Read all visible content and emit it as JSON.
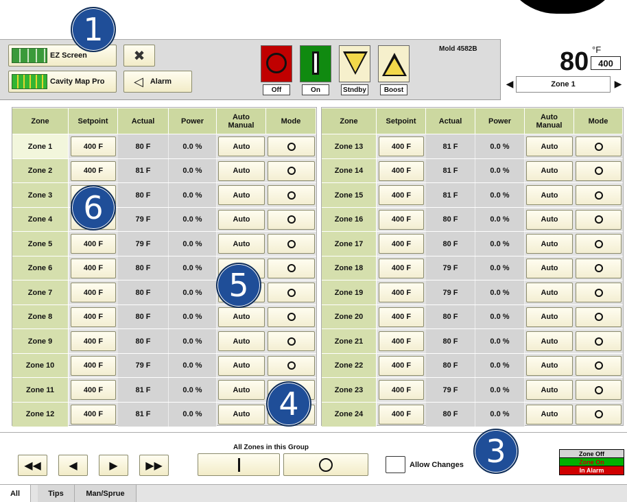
{
  "header": {
    "ez_screen_label": "EZ Screen",
    "cavity_map_label": "Cavity Map Pro",
    "alarm_label": "Alarm",
    "mold_name": "Mold 4582B",
    "states": [
      {
        "label": "Off",
        "color": "#c00000"
      },
      {
        "label": "On",
        "color": "#108a10"
      },
      {
        "label": "Stndby",
        "color": "#f2d84a"
      },
      {
        "label": "Boost",
        "color": "#f2d84a"
      }
    ],
    "current_temp": "80",
    "unit": "°F",
    "setpoint": "400",
    "zone_selector": "Zone 1"
  },
  "table": {
    "columns": [
      "Zone",
      "Setpoint",
      "Actual",
      "Power",
      "Auto\nManual",
      "Mode"
    ],
    "left_rows": [
      {
        "zone": "Zone 1",
        "setpoint": "400 F",
        "actual": "80 F",
        "power": "0.0 %",
        "auto": "Auto"
      },
      {
        "zone": "Zone 2",
        "setpoint": "400 F",
        "actual": "81 F",
        "power": "0.0 %",
        "auto": "Auto"
      },
      {
        "zone": "Zone 3",
        "setpoint": "400 F",
        "actual": "80 F",
        "power": "0.0 %",
        "auto": "Auto"
      },
      {
        "zone": "Zone 4",
        "setpoint": "400 F",
        "actual": "79 F",
        "power": "0.0 %",
        "auto": "Auto"
      },
      {
        "zone": "Zone 5",
        "setpoint": "400 F",
        "actual": "79 F",
        "power": "0.0 %",
        "auto": "Auto"
      },
      {
        "zone": "Zone 6",
        "setpoint": "400 F",
        "actual": "80 F",
        "power": "0.0 %",
        "auto": "Auto"
      },
      {
        "zone": "Zone 7",
        "setpoint": "400 F",
        "actual": "80 F",
        "power": "0.0 %",
        "auto": "Auto"
      },
      {
        "zone": "Zone 8",
        "setpoint": "400 F",
        "actual": "80 F",
        "power": "0.0 %",
        "auto": "Auto"
      },
      {
        "zone": "Zone 9",
        "setpoint": "400 F",
        "actual": "80 F",
        "power": "0.0 %",
        "auto": "Auto"
      },
      {
        "zone": "Zone 10",
        "setpoint": "400 F",
        "actual": "79 F",
        "power": "0.0 %",
        "auto": "Auto"
      },
      {
        "zone": "Zone 11",
        "setpoint": "400 F",
        "actual": "81 F",
        "power": "0.0 %",
        "auto": "Auto"
      },
      {
        "zone": "Zone 12",
        "setpoint": "400 F",
        "actual": "81 F",
        "power": "0.0 %",
        "auto": "Auto"
      }
    ],
    "right_rows": [
      {
        "zone": "Zone 13",
        "setpoint": "400 F",
        "actual": "81 F",
        "power": "0.0 %",
        "auto": "Auto"
      },
      {
        "zone": "Zone 14",
        "setpoint": "400 F",
        "actual": "81 F",
        "power": "0.0 %",
        "auto": "Auto"
      },
      {
        "zone": "Zone 15",
        "setpoint": "400 F",
        "actual": "81 F",
        "power": "0.0 %",
        "auto": "Auto"
      },
      {
        "zone": "Zone 16",
        "setpoint": "400 F",
        "actual": "80 F",
        "power": "0.0 %",
        "auto": "Auto"
      },
      {
        "zone": "Zone 17",
        "setpoint": "400 F",
        "actual": "80 F",
        "power": "0.0 %",
        "auto": "Auto"
      },
      {
        "zone": "Zone 18",
        "setpoint": "400 F",
        "actual": "79 F",
        "power": "0.0 %",
        "auto": "Auto"
      },
      {
        "zone": "Zone 19",
        "setpoint": "400 F",
        "actual": "79 F",
        "power": "0.0 %",
        "auto": "Auto"
      },
      {
        "zone": "Zone 20",
        "setpoint": "400 F",
        "actual": "80 F",
        "power": "0.0 %",
        "auto": "Auto"
      },
      {
        "zone": "Zone 21",
        "setpoint": "400 F",
        "actual": "80 F",
        "power": "0.0 %",
        "auto": "Auto"
      },
      {
        "zone": "Zone 22",
        "setpoint": "400 F",
        "actual": "80 F",
        "power": "0.0 %",
        "auto": "Auto"
      },
      {
        "zone": "Zone 23",
        "setpoint": "400 F",
        "actual": "79 F",
        "power": "0.0 %",
        "auto": "Auto"
      },
      {
        "zone": "Zone 24",
        "setpoint": "400 F",
        "actual": "80 F",
        "power": "0.0 %",
        "auto": "Auto"
      }
    ]
  },
  "bottom": {
    "all_zones_label": "All Zones in this Group",
    "allow_changes_label": "Allow Changes",
    "legend": [
      {
        "label": "Zone Off",
        "bg": "#d4d4d4",
        "fg": "#000000"
      },
      {
        "label": "Zone On",
        "bg": "#00b000",
        "fg": "#c00000"
      },
      {
        "label": "In Alarm",
        "bg": "#d00000",
        "fg": "#ffffff"
      }
    ]
  },
  "tabs": [
    "All",
    "Tips",
    "Man/Sprue"
  ],
  "callouts": [
    "1",
    "3",
    "4",
    "5",
    "6"
  ]
}
